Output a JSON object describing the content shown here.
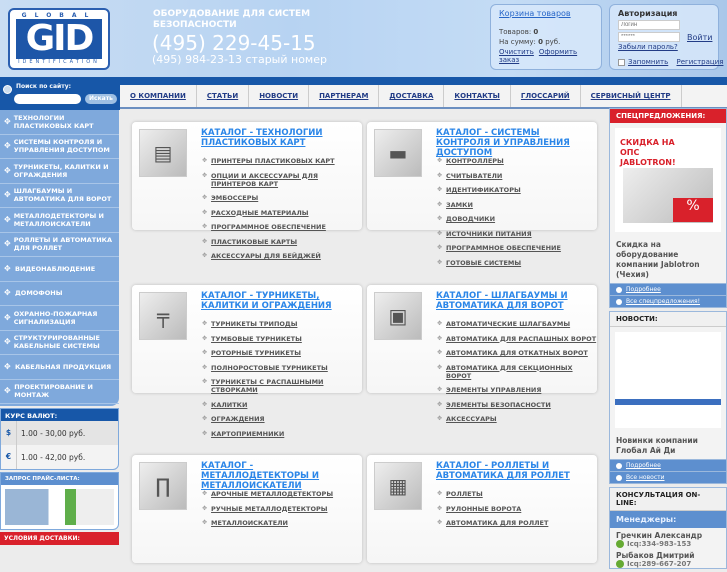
{
  "header": {
    "logo_top": "GLOBAL",
    "logo_main": "GID",
    "logo_bottom": "IDENTIFICATION",
    "tagline": "ОБОРУДОВАНИЕ ДЛЯ СИСТЕМ БЕЗОПАСНОСТИ",
    "phone": "(495) 229-45-15",
    "phone_old": "(495) 984-23-13 старый номер"
  },
  "cart": {
    "title": "Корзина товаров",
    "items_label": "Товаров:",
    "items": "0",
    "sum_label": "На сумму:",
    "sum": "0",
    "currency": "руб.",
    "clear": "Очистить",
    "checkout": "Оформить заказ"
  },
  "auth": {
    "title": "Авторизация",
    "login_placeholder": "Логин",
    "password_placeholder": "******",
    "login_button": "Войти",
    "forgot": "Забыли пароль?",
    "remember": "Запомнить",
    "register": "Регистрация"
  },
  "search": {
    "label": "Поиск по сайту:",
    "button": "Искать"
  },
  "nav": [
    "О КОМПАНИИ",
    "СТАТЬИ",
    "НОВОСТИ",
    "ПАРТНЕРАМ",
    "ДОСТАВКА",
    "КОНТАКТЫ",
    "ГЛОССАРИЙ",
    "СЕРВИСНЫЙ ЦЕНТР"
  ],
  "sidebar": [
    "ТЕХНОЛОГИИ ПЛАСТИКОВЫХ КАРТ",
    "СИСТЕМЫ КОНТРОЛЯ И УПРАВЛЕНИЯ ДОСТУПОМ",
    "ТУРНИКЕТЫ, КАЛИТКИ И ОГРАЖДЕНИЯ",
    "ШЛАГБАУМЫ И АВТОМАТИКА ДЛЯ ВОРОТ",
    "МЕТАЛЛОДЕТЕКТОРЫ И МЕТАЛЛОИСКАТЕЛИ",
    "РОЛЛЕТЫ И АВТОМАТИКА ДЛЯ РОЛЛЕТ",
    "ВИДЕОНАБЛЮДЕНИЕ",
    "ДОМОФОНЫ",
    "ОХРАННО-ПОЖАРНАЯ СИГНАЛИЗАЦИЯ",
    "СТРУКТУРИРОВАННЫЕ КАБЕЛЬНЫЕ СИСТЕМЫ",
    "КАБЕЛЬНАЯ ПРОДУКЦИЯ",
    "ПРОЕКТИРОВАНИЕ И МОНТАЖ"
  ],
  "currency": {
    "title": "КУРС ВАЛЮТ:",
    "rows": [
      {
        "symbol": "$",
        "value": "1.00 - 30,00 руб."
      },
      {
        "symbol": "€",
        "value": "1.00 - 42,00 руб."
      }
    ]
  },
  "price_request": {
    "title": "ЗАПРОС ПРАЙС-ЛИСТА:"
  },
  "delivery": {
    "title": "УСЛОВИЯ ДОСТАВКИ:"
  },
  "catalogs": [
    {
      "title": "КАТАЛОГ - ТЕХНОЛОГИИ ПЛАСТИКОВЫХ КАРТ",
      "icon": "card-printer",
      "items": [
        "ПРИНТЕРЫ ПЛАСТИКОВЫХ КАРТ",
        "ОПЦИИ И АКСЕССУАРЫ ДЛЯ ПРИНТЕРОВ КАРТ",
        "ЭМБОССЕРЫ",
        "РАСХОДНЫЕ МАТЕРИАЛЫ",
        "ПРОГРАММНОЕ ОБЕСПЕЧЕНИЕ",
        "ПЛАСТИКОВЫЕ КАРТЫ",
        "АКСЕССУАРЫ ДЛЯ БЕЙДЖЕЙ"
      ]
    },
    {
      "title": "КАТАЛОГ - СИСТЕМЫ КОНТРОЛЯ И УПРАВЛЕНИЯ ДОСТУПОМ",
      "icon": "lock",
      "items": [
        "КОНТРОЛЛЕРЫ",
        "СЧИТЫВАТЕЛИ",
        "ИДЕНТИФИКАТОРЫ",
        "ЗАМКИ",
        "ДОВОДЧИКИ",
        "ИСТОЧНИКИ ПИТАНИЯ",
        "ПРОГРАММНОЕ ОБЕСПЕЧЕНИЕ",
        "ГОТОВЫЕ СИСТЕМЫ"
      ]
    },
    {
      "title": "КАТАЛОГ - ТУРНИКЕТЫ, КАЛИТКИ И ОГРАЖДЕНИЯ",
      "icon": "turnstile",
      "items": [
        "ТУРНИКЕТЫ ТРИПОДЫ",
        "ТУМБОВЫЕ ТУРНИКЕТЫ",
        "РОТОРНЫЕ ТУРНИКЕТЫ",
        "ПОЛНОРОСТОВЫЕ ТУРНИКЕТЫ",
        "ТУРНИКЕТЫ С РАСПАШНЫМИ СТВОРКАМИ",
        "КАЛИТКИ",
        "ОГРАЖДЕНИЯ",
        "КАРТОПРИЕМНИКИ"
      ]
    },
    {
      "title": "КАТАЛОГ - ШЛАГБАУМЫ И АВТОМАТИКА ДЛЯ ВОРОТ",
      "icon": "barrier",
      "items": [
        "АВТОМАТИЧЕСКИЕ ШЛАГБАУМЫ",
        "АВТОМАТИКА ДЛЯ РАСПАШНЫХ ВОРОТ",
        "АВТОМАТИКА ДЛЯ ОТКАТНЫХ ВОРОТ",
        "АВТОМАТИКА ДЛЯ СЕКЦИОННЫХ ВОРОТ",
        "ЭЛЕМЕНТЫ УПРАВЛЕНИЯ",
        "ЭЛЕМЕНТЫ БЕЗОПАСНОСТИ",
        "АКСЕССУАРЫ"
      ]
    },
    {
      "title": "КАТАЛОГ - МЕТАЛЛОДЕТЕКТОРЫ И МЕТАЛЛОИСКАТЕЛИ",
      "icon": "metal-detector",
      "items": [
        "АРОЧНЫЕ МЕТАЛЛОДЕТЕКТОРЫ",
        "РУЧНЫЕ МЕТАЛЛОДЕТЕКТОРЫ",
        "МЕТАЛЛОИСКАТЕЛИ"
      ]
    },
    {
      "title": "КАТАЛОГ - РОЛЛЕТЫ И АВТОМАТИКА ДЛЯ РОЛЛЕТ",
      "icon": "garage",
      "items": [
        "РОЛЛЕТЫ",
        "РУЛОННЫЕ ВОРОТА",
        "АВТОМАТИКА ДЛЯ РОЛЛЕТ"
      ]
    }
  ],
  "special": {
    "title": "СПЕЦПРЕДЛОЖЕНИЯ:",
    "banner": "СКИДКА НА ОПС JABLOTRON!",
    "text": "Скидка на оборудование компании Jablotron (Чехия)",
    "more": "Подробнее",
    "all": "Все спецпредложения!"
  },
  "news": {
    "title": "НОВОСТИ:",
    "text": "Новинки компании Глобал Ай Ди",
    "more": "Подробнее",
    "all": "Все новости"
  },
  "consult": {
    "title": "КОНСУЛЬТАЦИЯ ON-LINE:",
    "subtitle": "Менеджеры:",
    "managers": [
      {
        "name": "Гречкин Александр",
        "icq": "Icq:334-983-153"
      },
      {
        "name": "Рыбаков Дмитрий",
        "icq": "Icq:289-667-207"
      }
    ]
  }
}
